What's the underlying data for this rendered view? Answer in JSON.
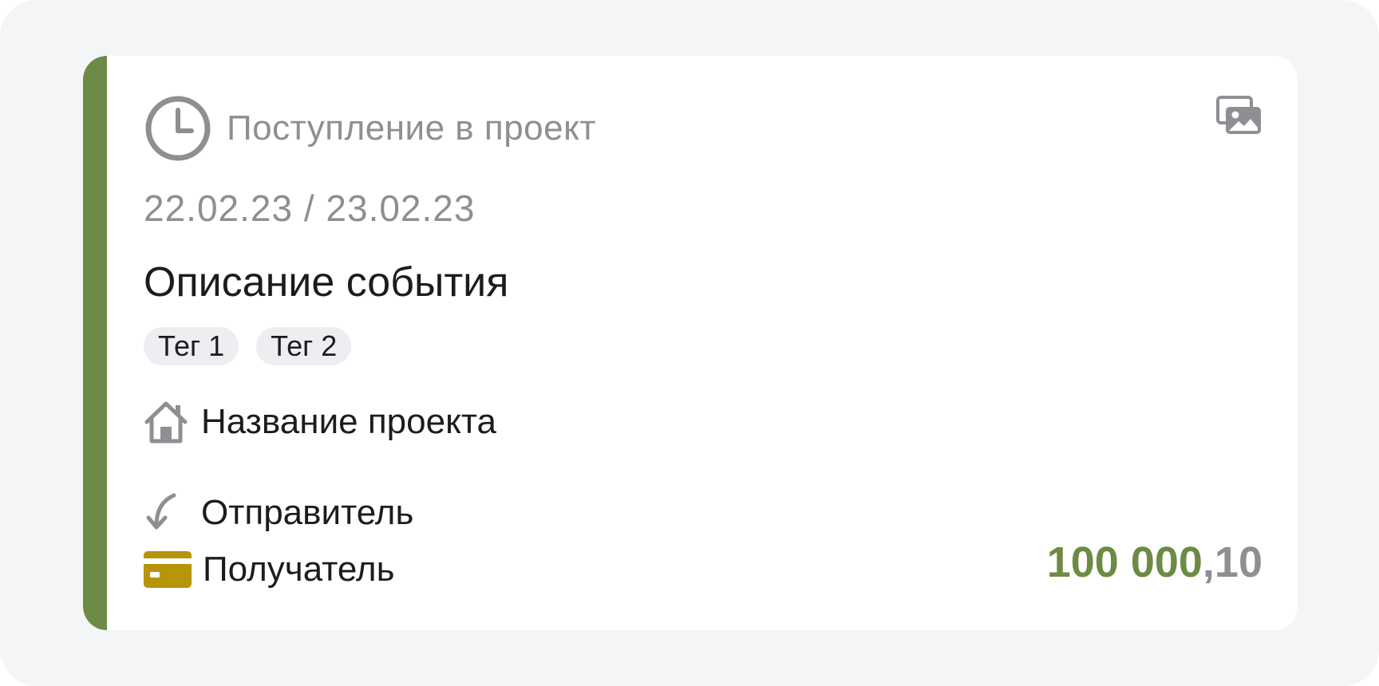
{
  "event": {
    "status_label": "Поступление в проект",
    "status_icon": "clock-icon",
    "dates": "22.02.23 / 23.02.23",
    "description": "Описание события",
    "tags": [
      {
        "label": "Тег 1"
      },
      {
        "label": "Тег 2"
      }
    ],
    "project": {
      "icon": "house-icon",
      "name": "Название проекта"
    },
    "sender": {
      "icon": "arrow-down-left-icon",
      "name": "Отправитель"
    },
    "recipient": {
      "icon": "card-icon",
      "name": "Получатель"
    },
    "amount": {
      "integer": "100 000",
      "fraction": ",10"
    },
    "gallery_icon": "gallery-icon"
  },
  "colors": {
    "accent": "#6c8b44",
    "muted_text": "#8e8e93",
    "primary_text": "#1c1c1e",
    "tag_background": "#eceef1",
    "card_icon": "#b8940a",
    "frame_background": "#f4f5f7"
  }
}
